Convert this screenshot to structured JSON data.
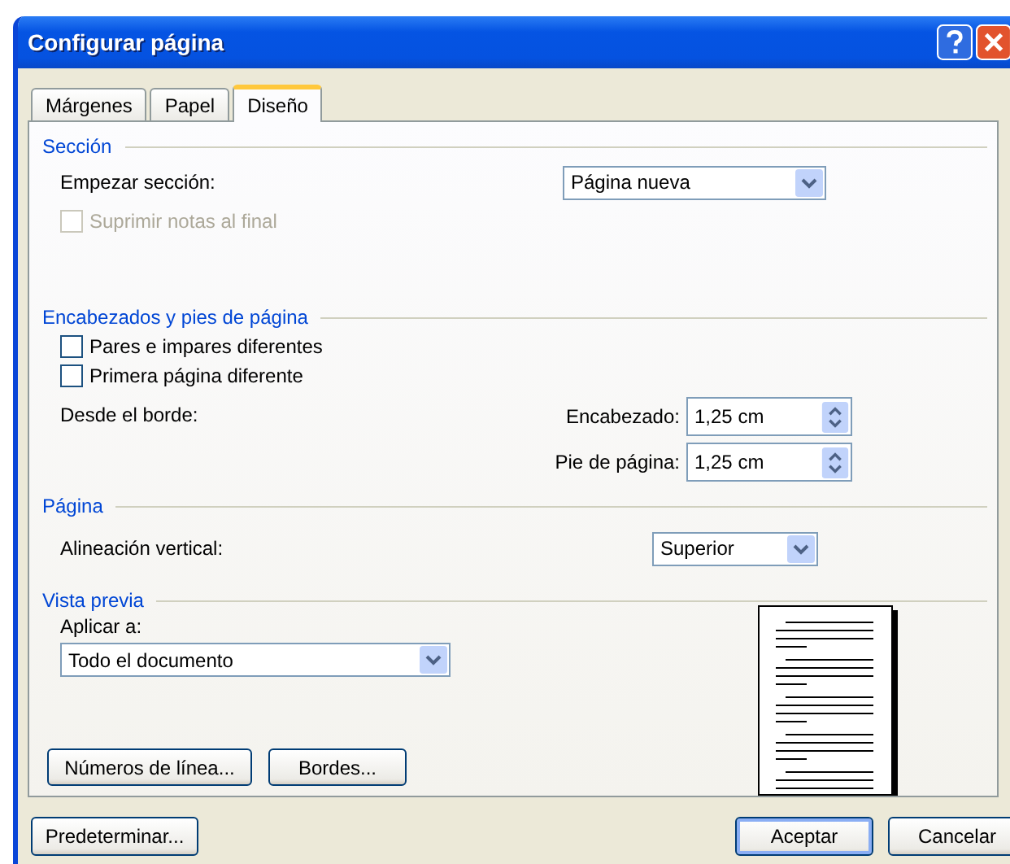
{
  "window": {
    "title": "Configurar página"
  },
  "tabs": [
    {
      "label": "Márgenes",
      "selected": false
    },
    {
      "label": "Papel",
      "selected": false
    },
    {
      "label": "Diseño",
      "selected": true
    }
  ],
  "section": {
    "heading": "Sección",
    "start_label": "Empezar sección:",
    "start_value": "Página nueva",
    "suppress_endnotes": {
      "label": "Suprimir notas al final",
      "checked": false,
      "disabled": true
    }
  },
  "headers_footers": {
    "heading": "Encabezados y pies de página",
    "options": [
      {
        "label": "Pares e impares diferentes",
        "checked": false,
        "disabled": false
      },
      {
        "label": "Primera página diferente",
        "checked": false,
        "disabled": false
      }
    ],
    "from_edge_label": "Desde el borde:",
    "spinners": [
      {
        "label": "Encabezado:",
        "value": "1,25 cm"
      },
      {
        "label": "Pie de página:",
        "value": "1,25 cm"
      }
    ]
  },
  "page": {
    "heading": "Página",
    "alignment_label": "Alineación vertical:",
    "alignment_value": "Superior"
  },
  "preview": {
    "heading": "Vista previa",
    "apply_label": "Aplicar a:",
    "apply_value": "Todo el documento",
    "buttons": [
      "Números de línea...",
      "Bordes..."
    ]
  },
  "buttons": [
    {
      "label": "Predeterminar...",
      "default": false
    },
    {
      "label": "Aceptar",
      "default": true
    },
    {
      "label": "Cancelar",
      "default": false
    }
  ]
}
